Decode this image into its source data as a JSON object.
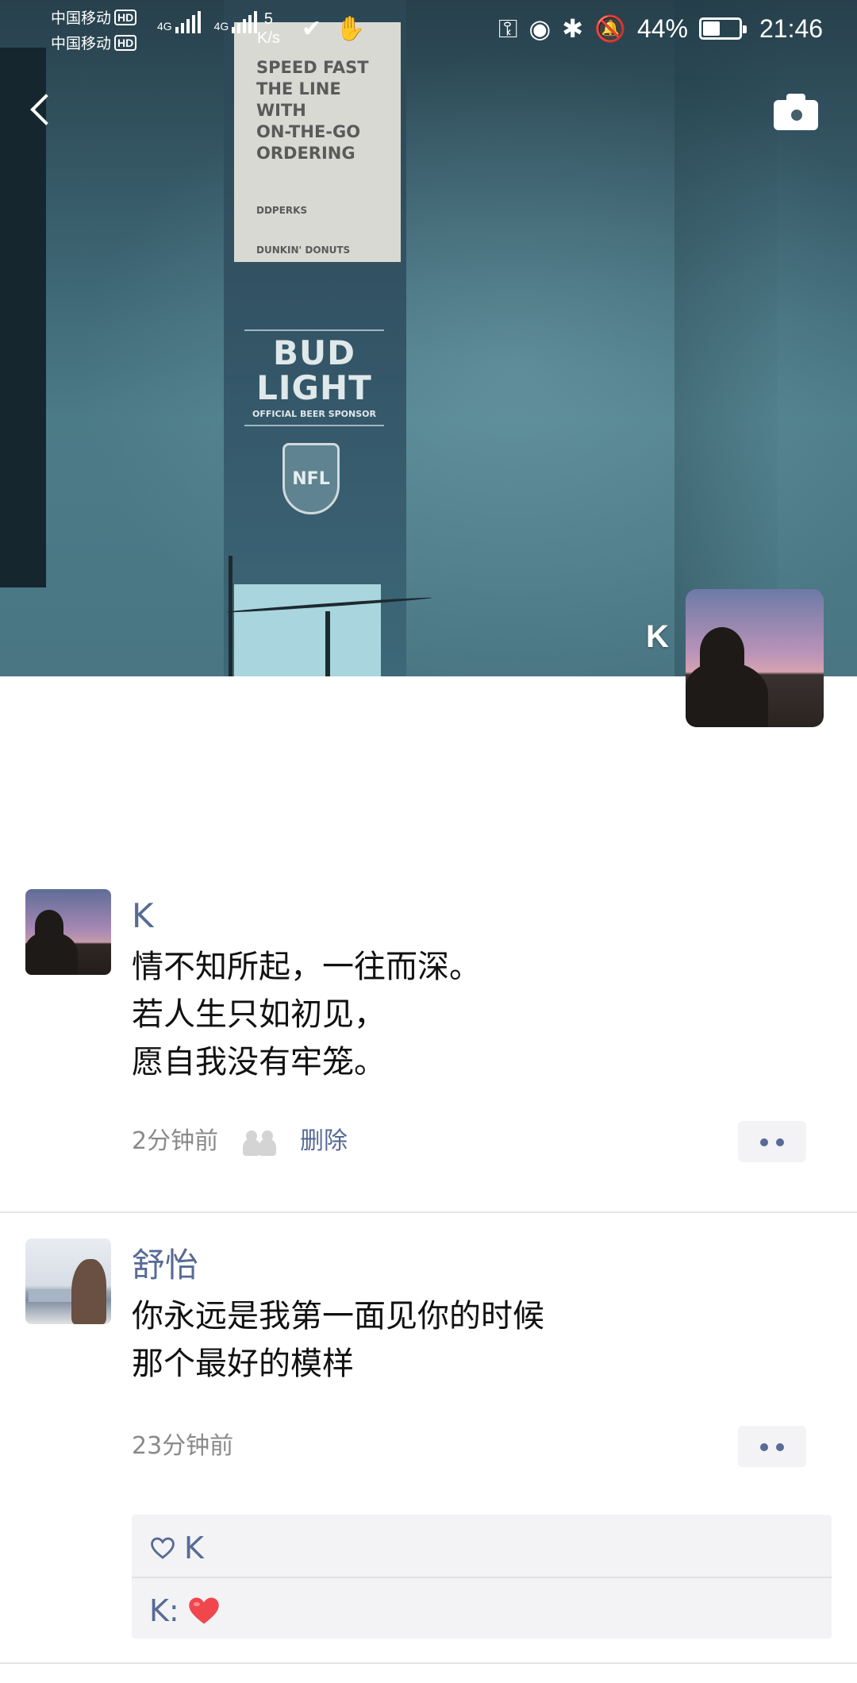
{
  "status_bar": {
    "carrier1": "中国移动",
    "carrier2": "中国移动",
    "hd": "HD",
    "net1": "4G",
    "net2": "4G",
    "speed_value": "5",
    "speed_unit": "K/s",
    "battery_percent": "44%",
    "battery_level": 0.44,
    "time": "21:46",
    "icons": [
      "key-icon",
      "eye-icon",
      "bluetooth-icon",
      "mute-bell-icon",
      "battery-icon"
    ]
  },
  "header": {
    "back_icon": "back-chevron-icon",
    "camera_icon": "camera-icon"
  },
  "cover": {
    "billboard_text": "SPEED FAST\nTHE LINE\nWITH\nON-THE-GO\nORDERING",
    "billboard_small": "DDPERKS",
    "billboard_bottom": "DUNKIN' DONUTS",
    "bud_line1": "BUD",
    "bud_line2": "LIGHT",
    "bud_sub": "OFFICIAL BEER SPONSOR",
    "nfl": "NFL"
  },
  "owner": {
    "name": "K"
  },
  "posts": [
    {
      "author": "K",
      "content": "情不知所起，一往而深。\n若人生只如初见，\n愿自我没有牢笼。",
      "time": "2分钟前",
      "delete_label": "删除"
    },
    {
      "author": "舒怡",
      "content": "你永远是我第一面见你的时候\n那个最好的模样",
      "time": "23分钟前",
      "likes": [
        "K"
      ],
      "comments": [
        {
          "author": "K:",
          "emoji": "red-heart"
        }
      ]
    }
  ],
  "colors": {
    "link_blue": "#576b95",
    "time_gray": "#8a8a8a",
    "panel_bg": "#f3f3f5",
    "heart_red": "#f0474f"
  }
}
